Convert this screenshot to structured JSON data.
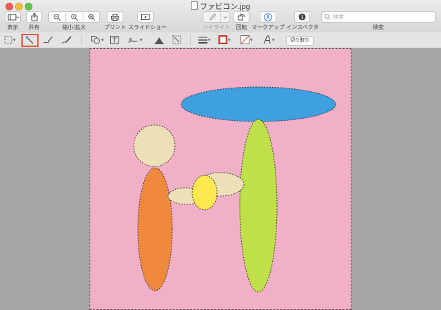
{
  "window": {
    "title": "ファビコン.jpg"
  },
  "toolbar": {
    "view_label": "表示",
    "share_label": "共有",
    "zoom_label": "縮小/拡大",
    "print_label": "プリント",
    "slideshow_label": "スライドショー",
    "highlight_label": "ハイライト",
    "rotate_label": "回転",
    "markup_label": "マークアップ",
    "inspector_label": "インスペクタ",
    "search_label": "検索",
    "search_placeholder": "検索"
  },
  "markup": {
    "crop_label": "切り取り",
    "selected_tool": "instant-alpha-icon",
    "selection_color": "#e05a47"
  },
  "icons": [
    "sidebar-icon",
    "share-icon",
    "zoom-out-icon",
    "zoom-actual-icon",
    "zoom-in-icon",
    "print-icon",
    "slideshow-icon",
    "highlight-pen-icon",
    "rotate-icon",
    "markup-pen-icon",
    "info-icon",
    "search-icon",
    "rect-selection-icon",
    "instant-alpha-icon",
    "sketch-icon",
    "draw-icon",
    "shapes-icon",
    "text-icon",
    "sign-icon",
    "adjust-color-icon",
    "adjust-size-icon",
    "line-style-icon",
    "border-color-icon",
    "fill-color-icon",
    "text-style-icon"
  ],
  "image": {
    "background": "#f2b0c8",
    "shapes": [
      {
        "name": "blue-ellipse",
        "color": "#3ea0de"
      },
      {
        "name": "beige-circle",
        "color": "#ede0b8"
      },
      {
        "name": "orange-ellipse",
        "color": "#ef8a3d"
      },
      {
        "name": "beige-ellipse",
        "color": "#ede0b8"
      },
      {
        "name": "yellow-circle",
        "color": "#fce94e"
      },
      {
        "name": "green-ellipse",
        "color": "#bfe048"
      }
    ]
  }
}
